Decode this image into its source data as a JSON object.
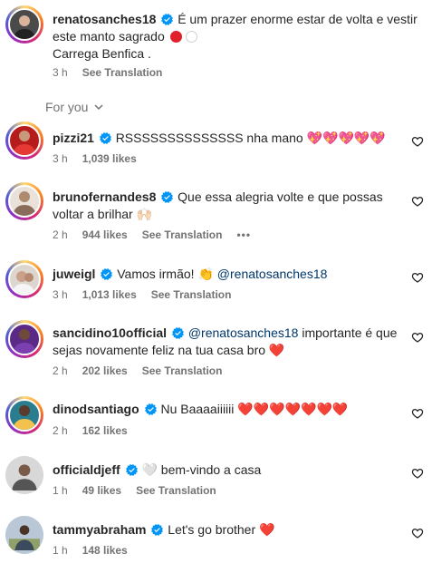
{
  "post": {
    "username": "renatosanches18",
    "caption": "É um prazer enorme estar de volta e vestir este manto sagrado",
    "caption_line2": "Carrega Benfica .",
    "time": "3 h",
    "see_translation": "See Translation"
  },
  "for_you_label": "For you",
  "comments": [
    {
      "username": "pizzi21",
      "text": "RSSSSSSSSSSSSSS nha mano",
      "emojis": "💖💖💖💖💖",
      "time": "3 h",
      "likes": "1,039 likes"
    },
    {
      "username": "brunofernandes8",
      "text": "Que essa alegria volte e que possas voltar a brilhar",
      "emojis": "🙌🏻",
      "time": "2 h",
      "likes": "944 likes",
      "see_translation": "See Translation",
      "more": "•••"
    },
    {
      "username": "juweigl",
      "text": "Vamos irmão!",
      "emojis": "👏",
      "mention": "@renatosanches18",
      "time": "3 h",
      "likes": "1,013 likes",
      "see_translation": "See Translation"
    },
    {
      "username": "sancidino10official",
      "mention": "@renatosanches18",
      "text": "importante é que sejas novamente feliz na tua casa bro",
      "emojis": "❤️",
      "time": "2 h",
      "likes": "202 likes",
      "see_translation": "See Translation"
    },
    {
      "username": "dinodsantiago",
      "text": "Nu Baaaaiiiiii",
      "emojis": "❤️❤️❤️❤️❤️❤️❤️",
      "time": "2 h",
      "likes": "162 likes"
    },
    {
      "username": "officialdjeff",
      "emojis": "🤍",
      "text": "bem-vindo a casa",
      "time": "1 h",
      "likes": "49 likes",
      "see_translation": "See Translation"
    },
    {
      "username": "tammyabraham",
      "text": "Let's go brother",
      "emojis": "❤️",
      "time": "1 h",
      "likes": "148 likes"
    }
  ],
  "colors": {
    "verified": "#0095f6",
    "mention": "#00376b",
    "meta": "#737373",
    "heart": "#ed4956"
  }
}
